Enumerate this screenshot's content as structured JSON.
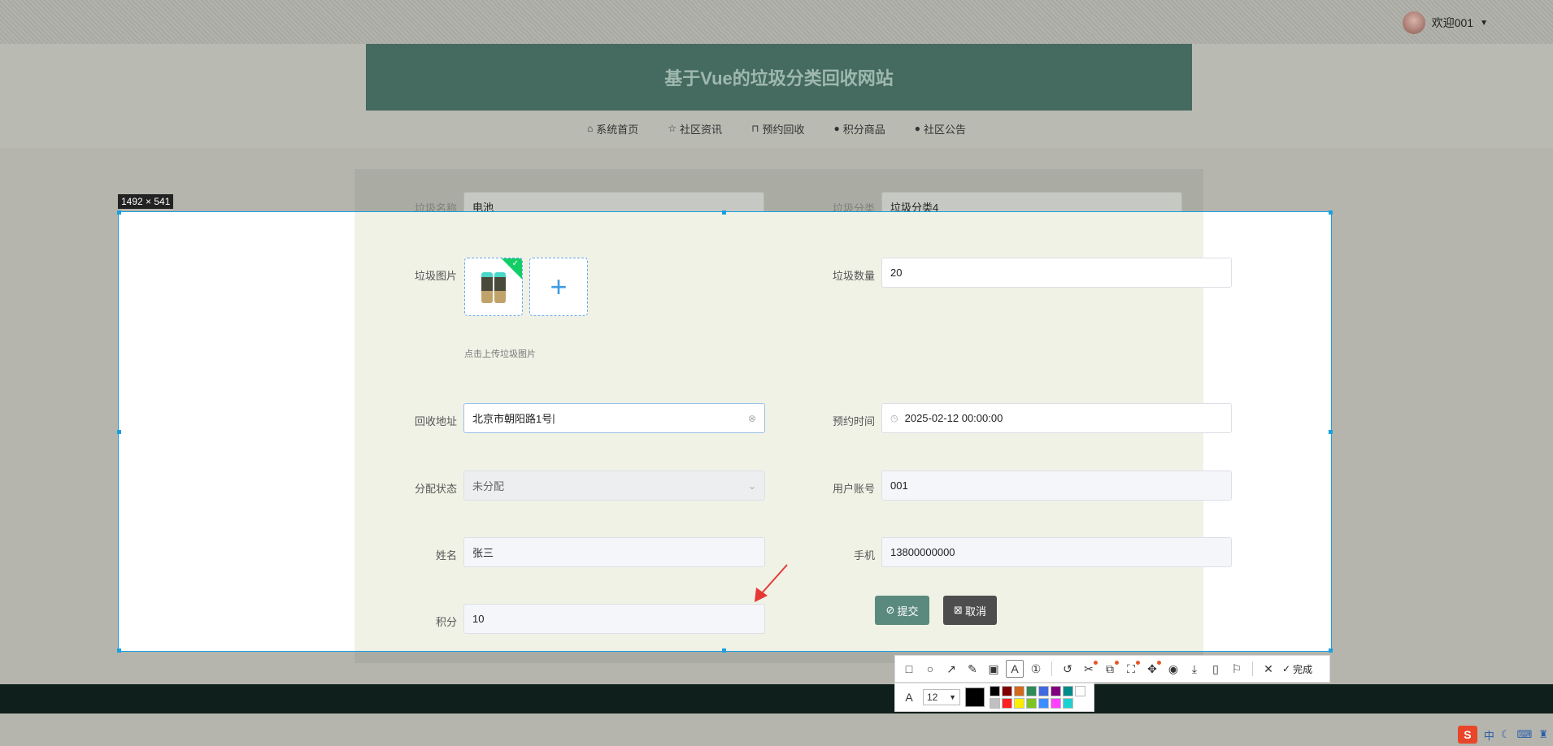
{
  "header": {
    "site_title": "基于Vue的垃圾分类回收网站",
    "user_label": "欢迎001",
    "user_caret": "▼"
  },
  "nav": {
    "items": [
      {
        "label": "系统首页",
        "icon": "home-icon",
        "glyph": "⌂"
      },
      {
        "label": "社区资讯",
        "icon": "star-icon",
        "glyph": "☆"
      },
      {
        "label": "预约回收",
        "icon": "bag-icon",
        "glyph": "⊓"
      },
      {
        "label": "积分商品",
        "icon": "info-icon",
        "glyph": "●"
      },
      {
        "label": "社区公告",
        "icon": "question-icon",
        "glyph": "●"
      }
    ]
  },
  "capture": {
    "size_label": "1492 × 541"
  },
  "form": {
    "garbage_name": {
      "label": "垃圾名称",
      "value": "电池"
    },
    "garbage_category": {
      "label": "垃圾分类",
      "value": "垃圾分类4"
    },
    "garbage_image": {
      "label": "垃圾图片",
      "hint": "点击上传垃圾图片",
      "add_glyph": "+"
    },
    "garbage_quantity": {
      "label": "垃圾数量",
      "value": "20"
    },
    "address": {
      "label": "回收地址",
      "value": "北京市朝阳路1号"
    },
    "appointment_time": {
      "label": "预约时间",
      "value": "2025-02-12 00:00:00"
    },
    "assign_status": {
      "label": "分配状态",
      "value": "未分配"
    },
    "user_account": {
      "label": "用户账号",
      "value": "001"
    },
    "name": {
      "label": "姓名",
      "value": "张三"
    },
    "phone": {
      "label": "手机",
      "value": "13800000000"
    },
    "points": {
      "label": "积分",
      "value": "10"
    },
    "submit_label": "提交",
    "cancel_label": "取消"
  },
  "toolbar": {
    "done_label": "完成",
    "font_size": "12",
    "current_color": "#000000",
    "palette": [
      "#000000",
      "#800000",
      "#d2691e",
      "#2e8b57",
      "#4169e1",
      "#800080",
      "#008b8b",
      "#ffffff",
      "#c0c0c0",
      "#ff2020",
      "#ffee00",
      "#7cc520",
      "#3c8dff",
      "#ff40ff",
      "#20d0d0"
    ]
  },
  "tray": {
    "ime_logo": "S",
    "ime_mode": "中"
  },
  "colors": {
    "banner": "#456a60",
    "accent": "#1a9fe0",
    "submit": "#5a8a7e",
    "cancel": "#4d4d4d",
    "footer": "#0f1f1b"
  }
}
